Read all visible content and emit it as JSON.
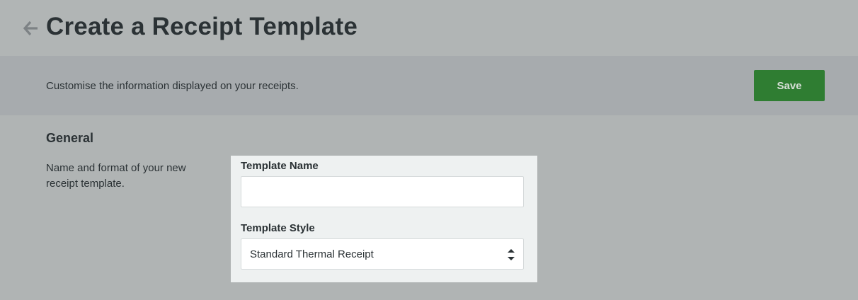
{
  "header": {
    "title": "Create a Receipt Template",
    "back_icon": "arrow-left-icon"
  },
  "banner": {
    "description": "Customise the information displayed on your receipts.",
    "save_label": "Save",
    "save_color": "#2f7d32"
  },
  "general": {
    "title": "General",
    "description": "Name and format of your new receipt template.",
    "template_name": {
      "label": "Template Name",
      "value": ""
    },
    "template_style": {
      "label": "Template Style",
      "selected": "Standard Thermal Receipt",
      "icon": "select-arrows-icon"
    }
  }
}
